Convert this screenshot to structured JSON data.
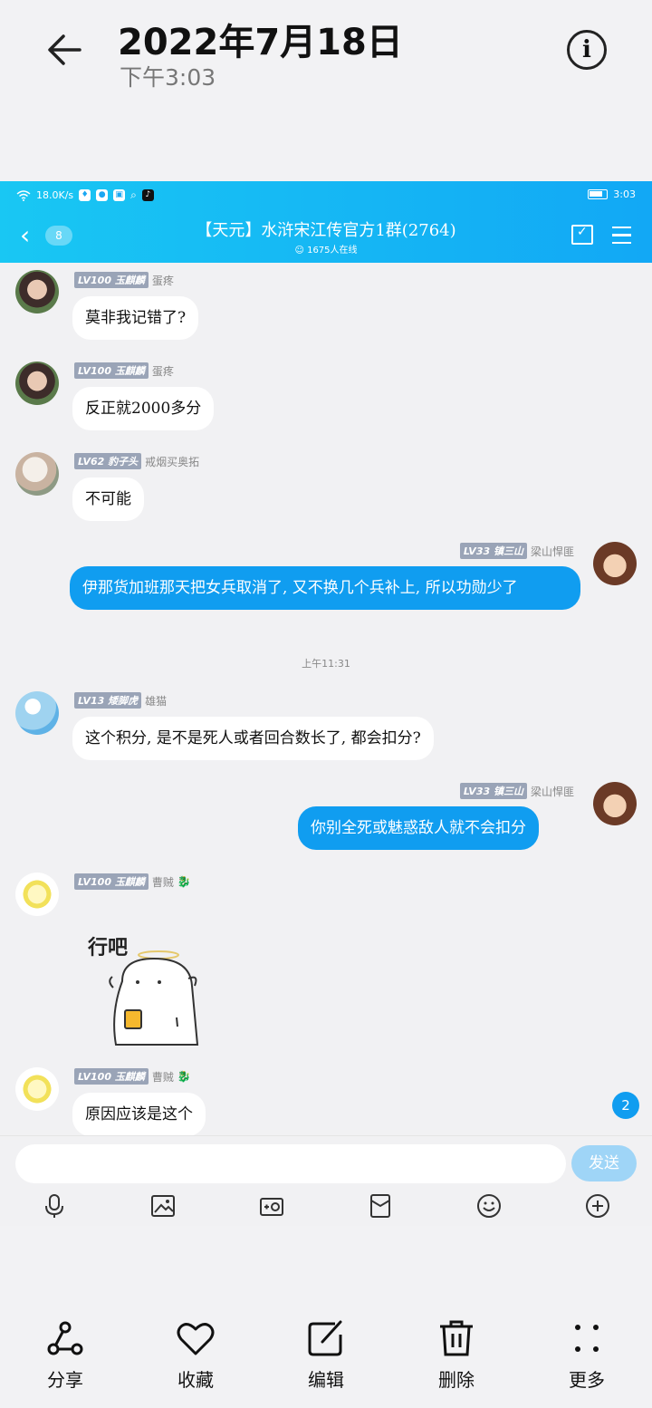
{
  "gallery": {
    "date": "2022年7月18日",
    "time": "下午3:03"
  },
  "status_bar": {
    "speed": "18.0K/s",
    "time": "3:03"
  },
  "chat_header": {
    "unread_count": "8",
    "title": "【天元】水浒宋江传官方1群(2764)",
    "online": "1675人在线"
  },
  "messages": [
    {
      "level": "LV100",
      "nick": "玉麒麟",
      "title": "蛋疼",
      "text": "莫非我记错了?"
    },
    {
      "level": "LV100",
      "nick": "玉麒麟",
      "title": "蛋疼",
      "text": "反正就2000多分"
    },
    {
      "level": "LV62",
      "nick": "豹子头",
      "title": "戒烟买奥拓",
      "text": "不可能"
    },
    {
      "level": "LV33",
      "nick": "镇三山",
      "title": "梁山悍匪",
      "text": "伊那货加班那天把女兵取消了, 又不换几个兵补上, 所以功勋少了"
    },
    {
      "level": "LV13",
      "nick": "矮脚虎",
      "title": "雄猫",
      "text": "这个积分, 是不是死人或者回合数长了, 都会扣分?"
    },
    {
      "level": "LV33",
      "nick": "镇三山",
      "title": "梁山悍匪",
      "text": "你别全死或魅惑敌人就不会扣分"
    },
    {
      "level": "LV100",
      "nick": "玉麒麟",
      "title": "曹贼",
      "sticker_text": "行吧"
    },
    {
      "level": "LV100",
      "nick": "玉麒麟",
      "title": "曹贼",
      "text": "原因应该是这个"
    }
  ],
  "timestamp": "上午11:31",
  "new_msg_count": "2",
  "composer": {
    "placeholder": "",
    "send_label": "发送"
  },
  "actions": [
    {
      "label": "分享",
      "icon": "share-icon"
    },
    {
      "label": "收藏",
      "icon": "heart-icon"
    },
    {
      "label": "编辑",
      "icon": "edit-icon"
    },
    {
      "label": "删除",
      "icon": "trash-icon"
    },
    {
      "label": "更多",
      "icon": "more-icon"
    }
  ],
  "colors": {
    "qq_blue": "#109df0",
    "header_gradient_start": "#19c7f3",
    "send_disabled": "#9fd5f7"
  }
}
